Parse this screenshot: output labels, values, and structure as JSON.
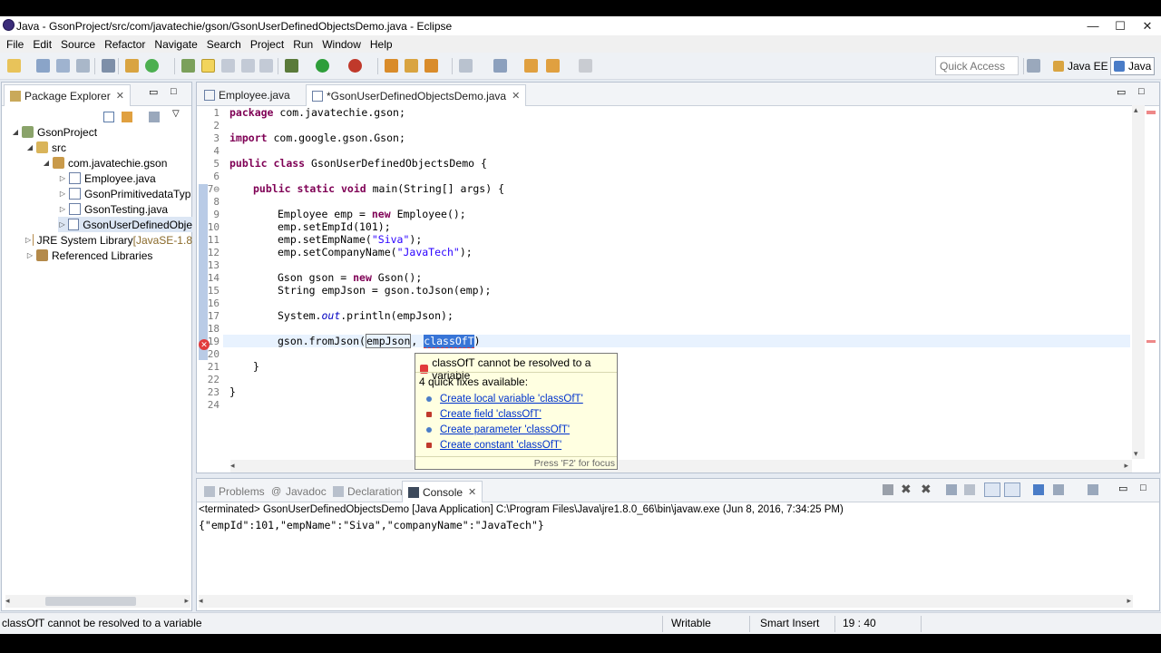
{
  "window": {
    "title": "Java - GsonProject/src/com/javatechie/gson/GsonUserDefinedObjectsDemo.java - Eclipse",
    "minimize": "—",
    "maximize": "☐",
    "close": "✕"
  },
  "menu": [
    "File",
    "Edit",
    "Source",
    "Refactor",
    "Navigate",
    "Search",
    "Project",
    "Run",
    "Window",
    "Help"
  ],
  "toolbar": {
    "quick_access_placeholder": "Quick Access",
    "perspectives": [
      "Java EE",
      "Java"
    ]
  },
  "package_explorer": {
    "tab_label": "Package Explorer",
    "tree": [
      {
        "label": "GsonProject",
        "level": 0,
        "expanded": true,
        "icon": "project-icon"
      },
      {
        "label": "src",
        "level": 1,
        "expanded": true,
        "icon": "source-folder-icon"
      },
      {
        "label": "com.javatechie.gson",
        "level": 2,
        "expanded": true,
        "icon": "package-icon"
      },
      {
        "label": "Employee.java",
        "level": 3,
        "icon": "java-file-icon"
      },
      {
        "label": "GsonPrimitivedataTyp",
        "level": 3,
        "icon": "java-file-icon"
      },
      {
        "label": "GsonTesting.java",
        "level": 3,
        "icon": "java-file-icon"
      },
      {
        "label": "GsonUserDefinedObje",
        "level": 3,
        "icon": "java-file-icon",
        "selected": true
      },
      {
        "label": "JRE System Library",
        "suffix": " [JavaSE-1.8",
        "level": 0,
        "icon": "library-icon"
      },
      {
        "label": "Referenced Libraries",
        "level": 0,
        "icon": "library-icon"
      }
    ]
  },
  "editor": {
    "tabs": [
      {
        "label": "Employee.java",
        "active": false
      },
      {
        "label": "*GsonUserDefinedObjectsDemo.java",
        "active": true
      }
    ],
    "line_numbers": [
      "1",
      "2",
      "3",
      "4",
      "5",
      "6",
      "7⊖",
      "8",
      "9",
      "10",
      "11",
      "12",
      "13",
      "14",
      "15",
      "16",
      "17",
      "18",
      "19",
      "20",
      "21",
      "22",
      "23",
      "24"
    ],
    "lines": {
      "l1_kw": "package",
      "l1_rest": " com.javatechie.gson;",
      "l3_kw": "import",
      "l3_rest": " com.google.gson.Gson;",
      "l5_kw1": "public",
      "l5_kw2": "class",
      "l5_rest": " GsonUserDefinedObjectsDemo {",
      "l7_kw1": "public",
      "l7_kw2": "static",
      "l7_kw3": "void",
      "l7_rest": " main(String[] args) {",
      "l9_a": "Employee emp = ",
      "l9_kw": "new",
      "l9_b": " Employee();",
      "l10": "emp.setEmpId(101);",
      "l11_a": "emp.setEmpName(",
      "l11_s": "\"Siva\"",
      "l11_b": ");",
      "l12_a": "emp.setCompanyName(",
      "l12_s": "\"JavaTech\"",
      "l12_b": ");",
      "l14_a": "Gson gson = ",
      "l14_kw": "new",
      "l14_b": " Gson();",
      "l15": "String empJson = gson.toJson(emp);",
      "l17_a": "System.",
      "l17_it": "out",
      "l17_b": ".println(empJson);",
      "l19_a": "gson.fromJson(",
      "l19_b": "empJson",
      "l19_c": ", ",
      "l19_sel": "classOfT",
      "l19_d": ")",
      "l21": "}",
      "l23": "}"
    }
  },
  "quickfix_popup": {
    "title": "classOfT cannot be resolved to a variable",
    "subtitle": "4 quick fixes available:",
    "fixes": [
      {
        "label": "Create local variable 'classOfT'",
        "color": "#4a7cc7"
      },
      {
        "label": "Create field 'classOfT'",
        "color": "#c0392b"
      },
      {
        "label": "Create parameter 'classOfT'",
        "color": "#4a7cc7"
      },
      {
        "label": "Create constant 'classOfT'",
        "color": "#c0392b"
      }
    ],
    "footer": "Press 'F2' for focus"
  },
  "bottom_panel": {
    "tabs": [
      "Problems",
      "Javadoc",
      "Declaration",
      "Console"
    ],
    "active_tab": "Console",
    "terminated": "<terminated> GsonUserDefinedObjectsDemo [Java Application] C:\\Program Files\\Java\\jre1.8.0_66\\bin\\javaw.exe (Jun 8, 2016, 7:34:25 PM)",
    "output": "{\"empId\":101,\"empName\":\"Siva\",\"companyName\":\"JavaTech\"}"
  },
  "status": {
    "message": "classOfT cannot be resolved to a variable",
    "writable": "Writable",
    "insert_mode": "Smart Insert",
    "position": "19 : 40"
  }
}
